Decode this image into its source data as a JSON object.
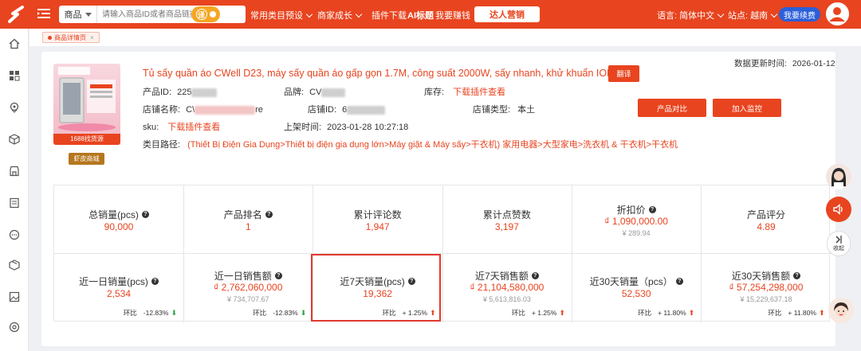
{
  "topbar": {
    "search_type": "商品",
    "search_placeholder": "请输入商品ID或者商品链接",
    "translate_label": "译",
    "nav": [
      "常用类目预设",
      "商家成长",
      "插件下载",
      "AI标题",
      "我要赚钱"
    ],
    "daren_label": "达人营销",
    "language": "语言: 简体中文",
    "site": "站点: 越南",
    "renew_label": "我要续费"
  },
  "tab": {
    "label": "商品详情页",
    "close": "×"
  },
  "product": {
    "badge_1688": "1688找货源",
    "shop_badge": "虾皮商城",
    "title": "Tủ sấy quần áo CWell D23, máy sấy quần áo gấp gọn 1.7M, công suất 2000W, sấy nhanh, khử khuẩn ION",
    "translate_btn": "翻译",
    "update_label": "数据更新时间:",
    "update_time": "2026-01-12",
    "product_id_label": "产品ID:",
    "product_id_prefix": "225",
    "brand_label": "品牌:",
    "brand_prefix": "CV",
    "stock_label": "库存:",
    "stock_value": "下载插件查看",
    "shop_name_label": "店铺名称:",
    "shop_name_prefix": "C\\",
    "shop_name_suffix": "re",
    "shop_id_label": "店铺ID:",
    "shop_id_prefix": "6",
    "shop_type_label": "店铺类型:",
    "shop_type_value": "本土",
    "sku_label": "sku:",
    "sku_value": "下载插件查看",
    "listed_label": "上架时间:",
    "listed_value": "2023-01-28 10:27:18",
    "category_label": "类目路径:",
    "category_value": "(Thiết Bị Điện Gia Dụng>Thiết bị điện gia dụng lớn>Máy giặt & Máy sấy>干衣机) 家用电器>大型家电>洗衣机 & 干衣机>干衣机",
    "compare_btn": "产品对比",
    "monitor_btn": "加入监控"
  },
  "metrics_row1": [
    {
      "label": "总销量(pcs)",
      "help": true,
      "value": "90,000"
    },
    {
      "label": "产品排名",
      "help": true,
      "value": "1"
    },
    {
      "label": "累计评论数",
      "help": false,
      "value": "1,947"
    },
    {
      "label": "累计点赞数",
      "help": false,
      "value": "3,197"
    },
    {
      "label": "折扣价",
      "help": true,
      "value": "₫ 1,090,000.00",
      "sub": "¥ 289.94"
    },
    {
      "label": "产品评分",
      "help": false,
      "value": "4.89"
    }
  ],
  "metrics_row2": [
    {
      "label": "近一日销量(pcs)",
      "help": true,
      "value": "2,534",
      "ratio_label": "环比",
      "ratio": "-12.83%",
      "dir": "down"
    },
    {
      "label": "近一日销售额",
      "help": true,
      "value": "₫ 2,762,060,000",
      "sub": "¥ 734,707.67",
      "ratio_label": "环比",
      "ratio": "-12.83%",
      "dir": "down"
    },
    {
      "label": "近7天销量(pcs)",
      "help": true,
      "value": "19,362",
      "ratio_label": "环比",
      "ratio": "+ 1.25%",
      "dir": "up"
    },
    {
      "label": "近7天销售额",
      "help": true,
      "value": "₫ 21,104,580,000",
      "sub": "¥ 5,613,816.03",
      "ratio_label": "环比",
      "ratio": "+ 1.25%",
      "dir": "up"
    },
    {
      "label": "近30天销量（pcs）",
      "help": true,
      "value": "52,530",
      "ratio_label": "环比",
      "ratio": "+ 11.80%",
      "dir": "up"
    },
    {
      "label": "近30天销售额",
      "help": true,
      "value": "₫ 57,254,298,000",
      "sub": "¥ 15,229,637.18",
      "ratio_label": "环比",
      "ratio": "+ 11.80%",
      "dir": "up"
    }
  ],
  "float": {
    "collapse_label": "收起"
  },
  "colors": {
    "brand": "#e8441f",
    "renew": "#2b5fd9",
    "up": "#e8441f",
    "down": "#2ea043"
  }
}
